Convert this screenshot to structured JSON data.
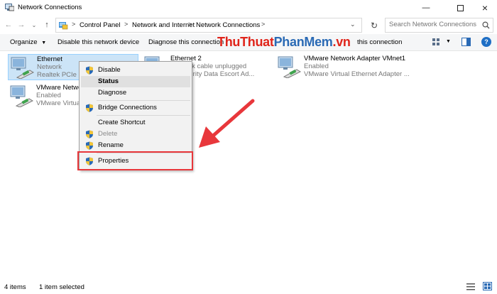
{
  "window": {
    "title": "Network Connections",
    "controls": [
      "minimize",
      "maximize",
      "close"
    ]
  },
  "address_bar": {
    "crumbs": [
      "Control Panel",
      "Network and Internet",
      "Network Connections"
    ],
    "search_placeholder": "Search Network Connections"
  },
  "command_bar": {
    "organize": "Organize",
    "disable": "Disable this network device",
    "diagnose": "Diagnose this connection",
    "rename": "this connection"
  },
  "watermark": {
    "part1": "ThuThuat",
    "part2": "PhanMem",
    "part3": ".vn"
  },
  "connections": [
    {
      "name": "Ethernet",
      "status": "Network",
      "device": "Realtek PCIe GB"
    },
    {
      "name": "Ethernet 2",
      "status": "Network cable unplugged",
      "device": "ty Security Data Escort Ad..."
    },
    {
      "name": "VMware Network Adapter VMnet1",
      "status": "Enabled",
      "device": "VMware Virtual Ethernet Adapter ..."
    },
    {
      "name": "VMware Netwo",
      "status": "Enabled",
      "device": "VMware Virtual"
    }
  ],
  "context_menu": {
    "items": [
      {
        "label": "Disable",
        "shield": true
      },
      {
        "label": "Status",
        "bold": true
      },
      {
        "label": "Diagnose"
      },
      {
        "label": "Bridge Connections",
        "shield": true
      },
      {
        "label": "Create Shortcut"
      },
      {
        "label": "Delete",
        "disabled": true,
        "shield": true
      },
      {
        "label": "Rename",
        "shield": true
      },
      {
        "label": "Properties",
        "shield": true
      }
    ]
  },
  "status_bar": {
    "items_count": "4 items",
    "selected": "1 item selected"
  },
  "colors": {
    "selection": "#cce4f7",
    "annotation_red": "#e8373b",
    "watermark_red": "#e0241a",
    "watermark_blue": "#2a6ab5"
  }
}
